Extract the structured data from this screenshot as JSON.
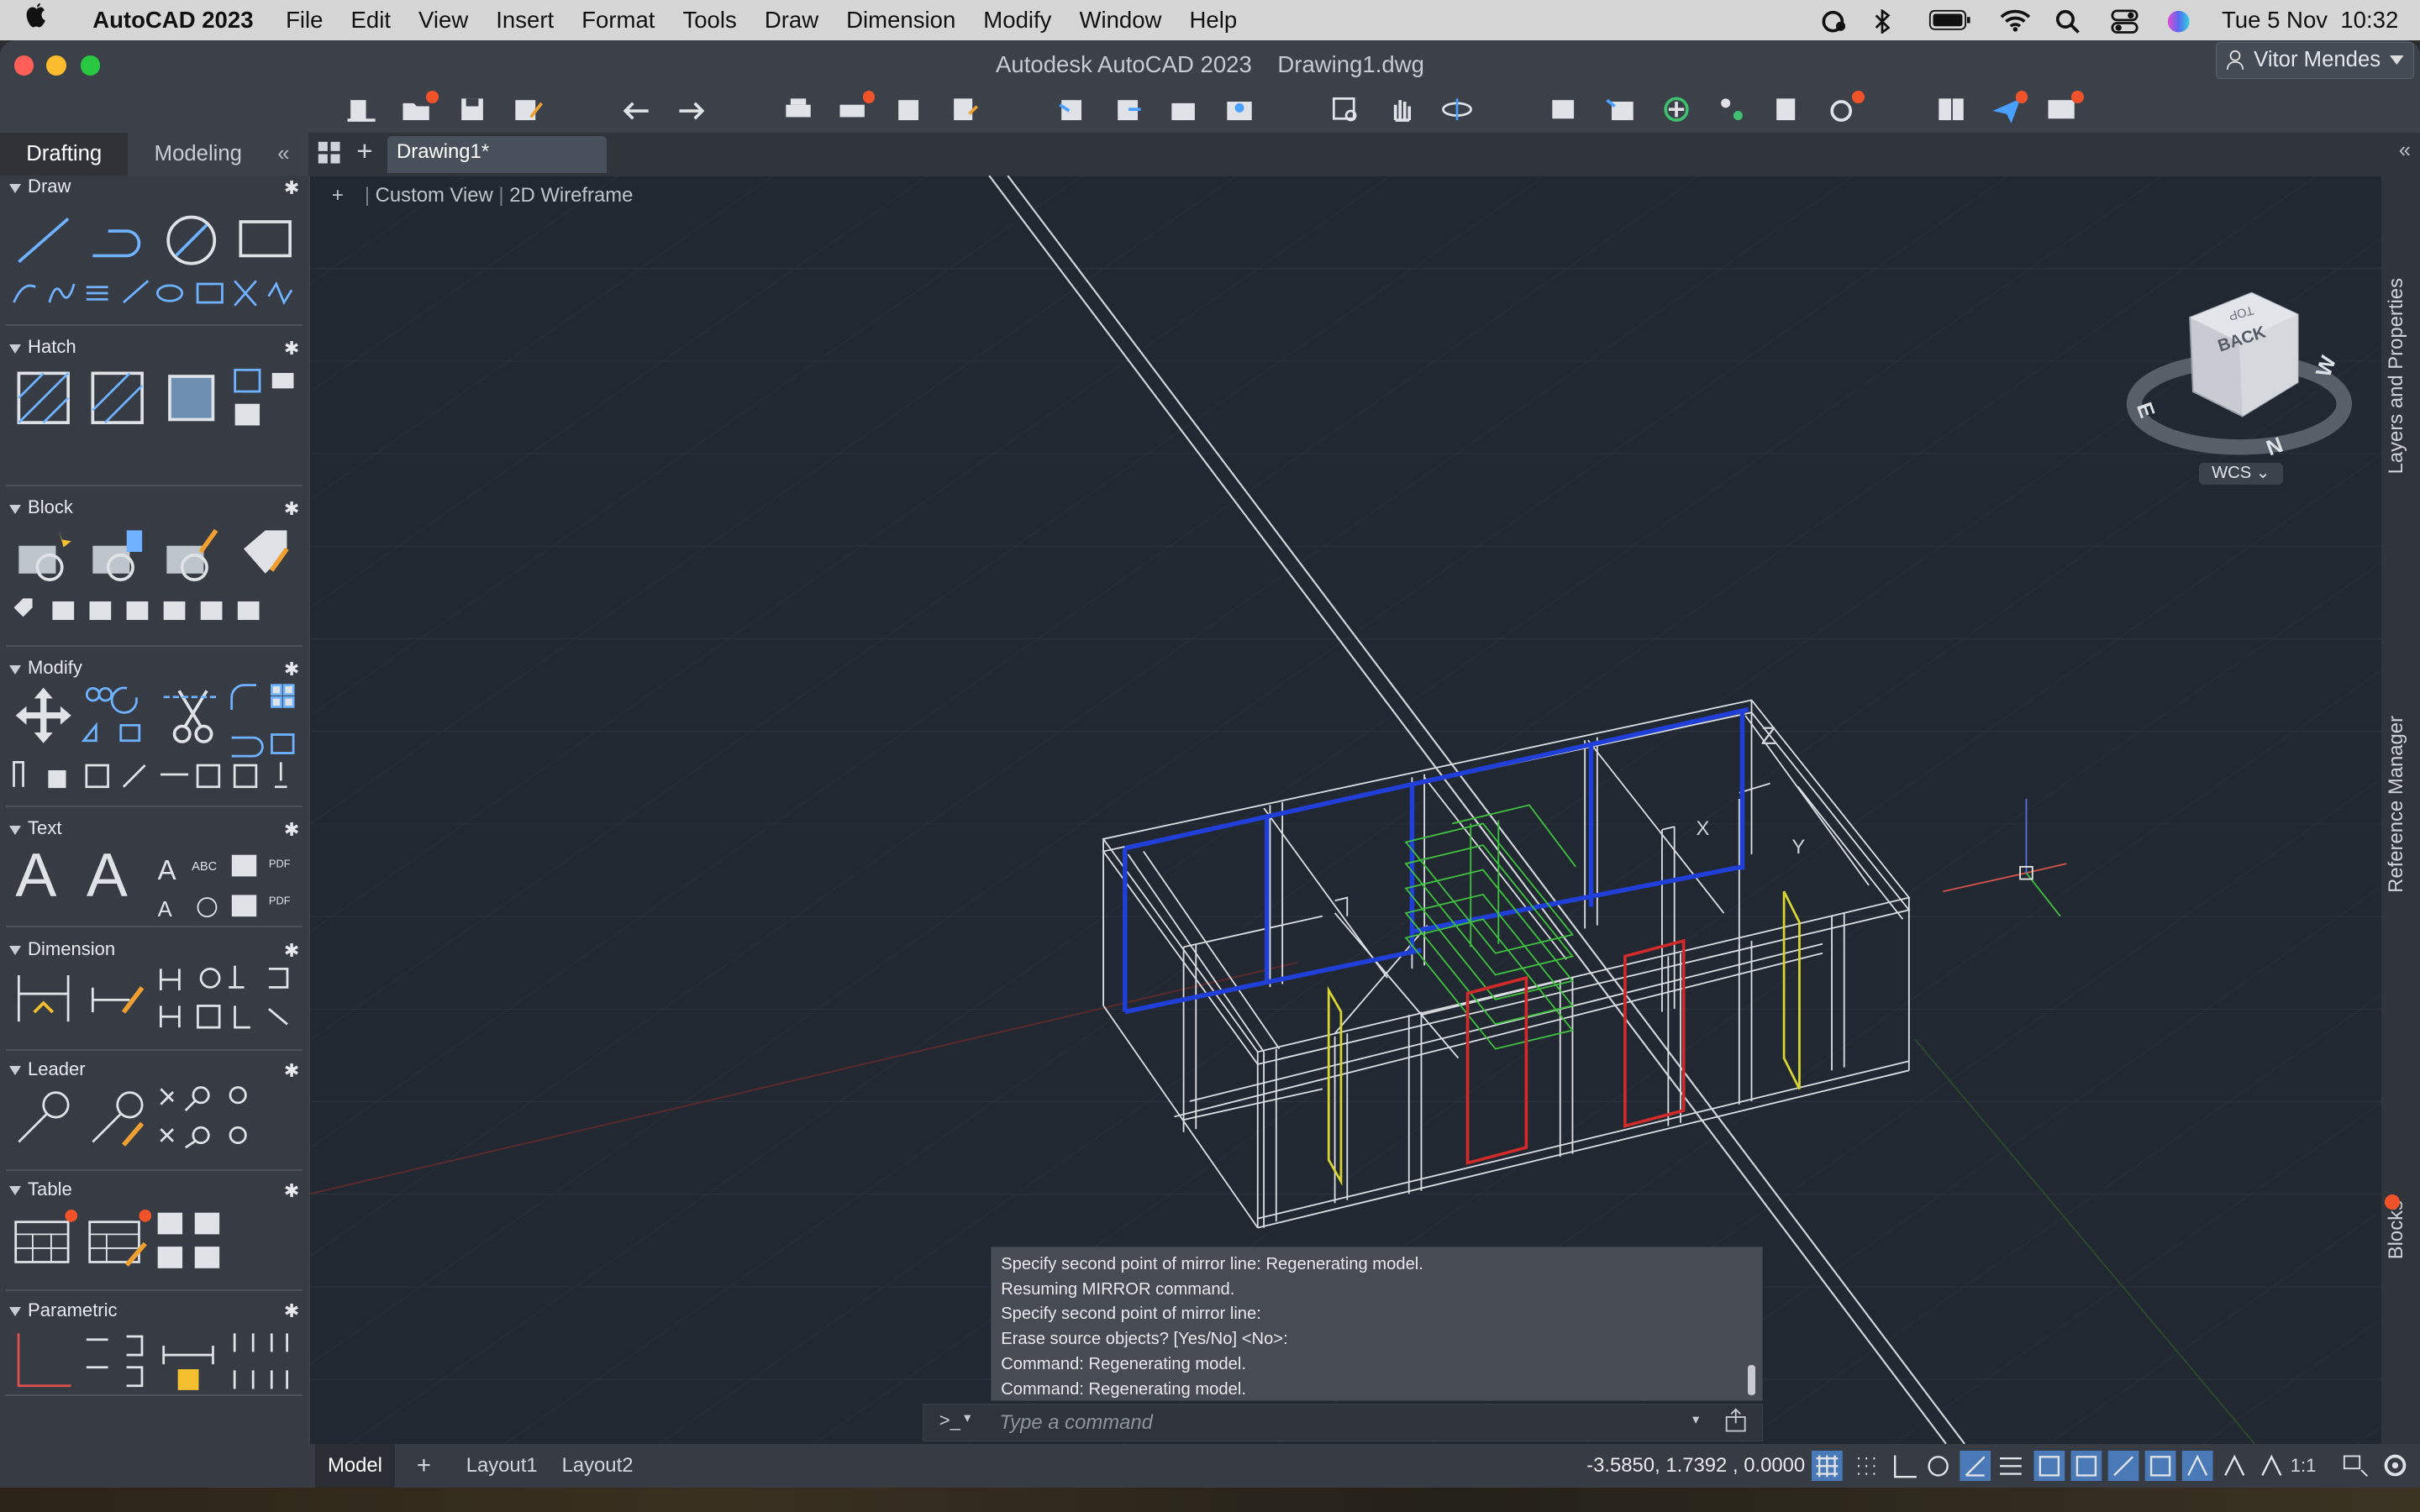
{
  "menubar": {
    "app": "AutoCAD 2023",
    "items": [
      "File",
      "Edit",
      "View",
      "Insert",
      "Format",
      "Tools",
      "Draw",
      "Dimension",
      "Modify",
      "Window",
      "Help"
    ],
    "datetime": "Tue 5 Nov  10:32"
  },
  "window": {
    "title": "Autodesk AutoCAD 2023    Drawing1.dwg",
    "user": "Vitor Mendes"
  },
  "workspace_tabs": [
    "Drafting",
    "Modeling"
  ],
  "document_tab": "Drawing1*",
  "palette": {
    "sections": [
      "Draw",
      "Hatch",
      "Block",
      "Modify",
      "Text",
      "Dimension",
      "Leader",
      "Table",
      "Parametric"
    ]
  },
  "viewport": {
    "plus": "+",
    "view": "Custom View",
    "style": "2D Wireframe",
    "wcs": "WCS",
    "viewcube_face": "BACK",
    "viewcube_top": "TOP",
    "compass": [
      "N",
      "E",
      "W"
    ],
    "axis": [
      "X",
      "Y",
      "Z"
    ]
  },
  "right_panels": [
    "Layers and Properties",
    "Reference Manager",
    "Blocks"
  ],
  "command": {
    "history": [
      "Specify second point of mirror line:  Regenerating model.",
      "Resuming MIRROR command.",
      "Specify second point of mirror line:",
      "Erase source objects? [Yes/No] <No>:",
      "Command:  Regenerating model.",
      "Command:  Regenerating model."
    ],
    "prompt": ">_",
    "placeholder": "Type a command"
  },
  "layout_tabs": [
    "Model",
    "Layout1",
    "Layout2"
  ],
  "status": {
    "coords": "-3.5850, 1.7392 , 0.0000",
    "scale": "1:1"
  },
  "colors": {
    "accent": "#f0532a",
    "blue_walls": "#1f3fd8",
    "red_door": "#d12a2a",
    "green_stair": "#3fbf3f",
    "yellow_window": "#d8d432"
  }
}
